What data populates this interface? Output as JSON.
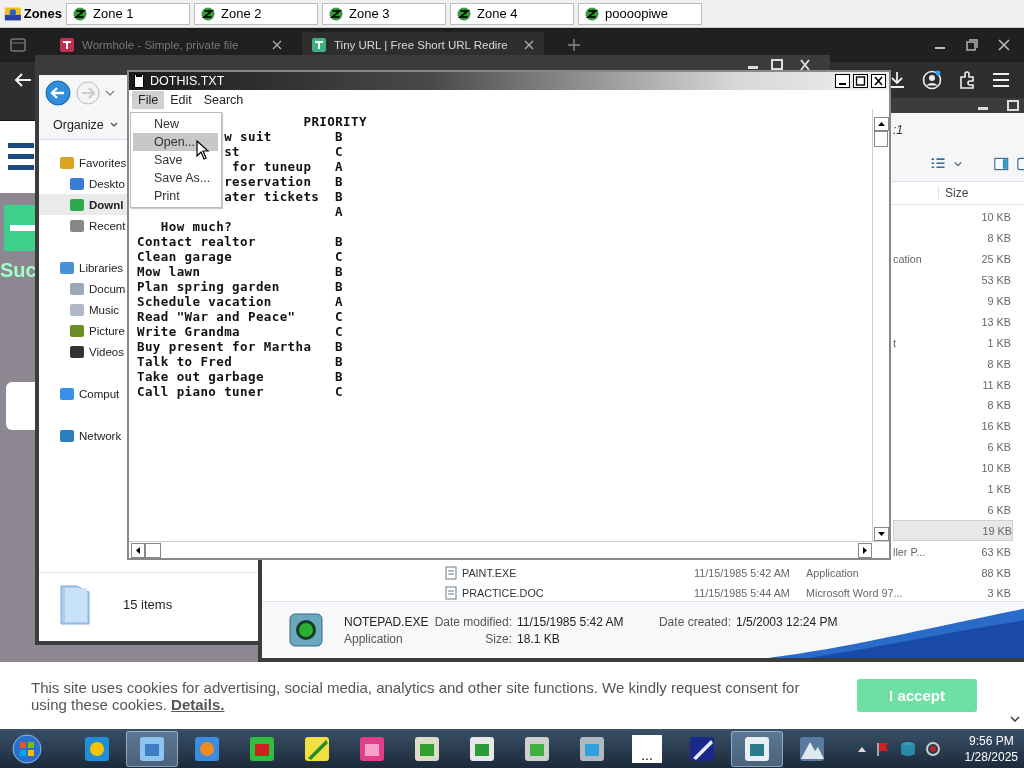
{
  "zones_bar": {
    "label": "Zones",
    "tabs": [
      {
        "label": "Zone 1"
      },
      {
        "label": "Zone 2"
      },
      {
        "label": "Zone 3"
      },
      {
        "label": "Zone 4"
      },
      {
        "label": "poooopiwe"
      }
    ]
  },
  "browser": {
    "tabs": [
      {
        "title": "Wormhole - Simple, private file",
        "selected": false
      },
      {
        "title": "Tiny URL | Free Short URL Redire",
        "selected": true
      }
    ],
    "page_logo_text": "Suc"
  },
  "cookie_banner": {
    "text": "This site uses cookies for advertising, social media, analytics and other site functions. We kindly request consent for using these cookies.",
    "link": "Details.",
    "button": "I accept"
  },
  "explorer_left": {
    "organize": "Organize",
    "nav": [
      {
        "label": "Favorites",
        "selected": false,
        "children": [
          {
            "label": "Deskto",
            "selected": false
          },
          {
            "label": "Downl",
            "selected": true
          },
          {
            "label": "Recent",
            "selected": false
          }
        ]
      },
      {
        "label": "Libraries",
        "selected": false,
        "children": [
          {
            "label": "Docum",
            "selected": false
          },
          {
            "label": "Music",
            "selected": false
          },
          {
            "label": "Picture",
            "selected": false
          },
          {
            "label": "Videos",
            "selected": false
          }
        ]
      },
      {
        "label": "Comput",
        "selected": false
      },
      {
        "label": "Network",
        "selected": false
      }
    ],
    "status": "15 items"
  },
  "explorer_right": {
    "address": ":1",
    "size_header": "Size",
    "rows": [
      {
        "kind": "clipped",
        "size": "10 KB",
        "selected": false
      },
      {
        "kind": "clipped",
        "size": "8 KB",
        "selected": false
      },
      {
        "kind": "clipped",
        "type": "cation",
        "size": "25 KB",
        "selected": false
      },
      {
        "kind": "clipped",
        "size": "53 KB",
        "selected": false
      },
      {
        "kind": "clipped",
        "size": "9 KB",
        "selected": false
      },
      {
        "kind": "clipped",
        "size": "13 KB",
        "selected": false
      },
      {
        "kind": "clipped",
        "type": "t",
        "size": "1 KB",
        "selected": false
      },
      {
        "kind": "clipped",
        "size": "8 KB",
        "selected": false
      },
      {
        "kind": "clipped",
        "size": "11 KB",
        "selected": false
      },
      {
        "kind": "clipped",
        "size": "8 KB",
        "selected": false
      },
      {
        "kind": "clipped",
        "size": "16 KB",
        "selected": false
      },
      {
        "kind": "clipped",
        "size": "6 KB",
        "selected": false
      },
      {
        "kind": "clipped",
        "size": "10 KB",
        "selected": false
      },
      {
        "kind": "clipped",
        "size": "1 KB",
        "selected": false
      },
      {
        "kind": "clipped",
        "size": "6 KB",
        "selected": false
      },
      {
        "kind": "clipped",
        "size": "19 KB",
        "selected": true
      },
      {
        "kind": "clipped",
        "type": "ller P...",
        "size": "63 KB",
        "selected": false
      },
      {
        "kind": "full",
        "name": "PAINT.EXE",
        "date": "11/15/1985 5:42 AM",
        "type": "Application",
        "size": "88 KB",
        "selected": false
      },
      {
        "kind": "full",
        "name": "PRACTICE.DOC",
        "date": "11/15/1985 5:44 AM",
        "type": "Microsoft Word 97...",
        "size": "3 KB",
        "selected": false
      }
    ],
    "details": {
      "name": "NOTEPAD.EXE",
      "modified_label": "Date modified:",
      "modified": "11/15/1985 5:42 AM",
      "created_label": "Date created:",
      "created": "1/5/2003 12:24 PM",
      "type": "Application",
      "size_label": "Size:",
      "size": "18.1 KB"
    }
  },
  "notepad": {
    "title": "DOTHIS.TXT",
    "menu": [
      {
        "label": "File",
        "selected": true
      },
      {
        "label": "Edit",
        "selected": false
      },
      {
        "label": "Search",
        "selected": false
      }
    ],
    "lines": [
      {
        "text": "                     PRIORITY"
      },
      {
        "text": "           w suit",
        "priority": "B"
      },
      {
        "text": "           st",
        "priority": "C"
      },
      {
        "text": "            for tuneup",
        "priority": "A"
      },
      {
        "text": "           reservation",
        "priority": "B"
      },
      {
        "text": "           ater tickets",
        "priority": "B"
      },
      {
        "priority": "A"
      },
      {
        "text": "   How much?"
      },
      {
        "text": "Contact realtor",
        "priority": "B"
      },
      {
        "text": "Clean garage",
        "priority": "C"
      },
      {
        "text": "Mow lawn",
        "priority": "B"
      },
      {
        "text": "Plan spring garden",
        "priority": "B"
      },
      {
        "text": "Schedule vacation",
        "priority": "A"
      },
      {
        "text": "Read \"War and Peace\"",
        "priority": "C"
      },
      {
        "text": "Write Grandma",
        "priority": "C"
      },
      {
        "text": "Buy present for Martha",
        "priority": "B"
      },
      {
        "text": "Talk to Fred",
        "priority": "B"
      },
      {
        "text": "Take out garbage",
        "priority": "B"
      },
      {
        "text": "Call piano tuner",
        "priority": "C"
      }
    ],
    "file_menu": [
      {
        "label": "New",
        "selected": false
      },
      {
        "label": "Open...",
        "selected": true
      },
      {
        "label": "Save",
        "selected": false
      },
      {
        "label": "Save As...",
        "selected": false
      },
      {
        "label": "Print",
        "selected": false
      }
    ]
  },
  "taskbar": {
    "buttons": [
      {
        "kind": "browser",
        "selected": false
      },
      {
        "kind": "folder",
        "selected": true
      },
      {
        "kind": "media",
        "selected": false
      },
      {
        "kind": "xy",
        "selected": false
      },
      {
        "kind": "pencil",
        "selected": false
      },
      {
        "kind": "box",
        "selected": false
      },
      {
        "kind": "music",
        "selected": false
      },
      {
        "kind": "sheet",
        "selected": false
      },
      {
        "kind": "printer",
        "selected": false
      },
      {
        "kind": "network",
        "selected": false
      },
      {
        "kind": "blank",
        "label": "...",
        "selected": false
      },
      {
        "kind": "plane",
        "selected": false
      },
      {
        "kind": "panel",
        "selected": true
      },
      {
        "kind": "mountain",
        "selected": false
      }
    ],
    "clock": {
      "time": "9:56 PM",
      "date": "1/28/2025"
    }
  }
}
